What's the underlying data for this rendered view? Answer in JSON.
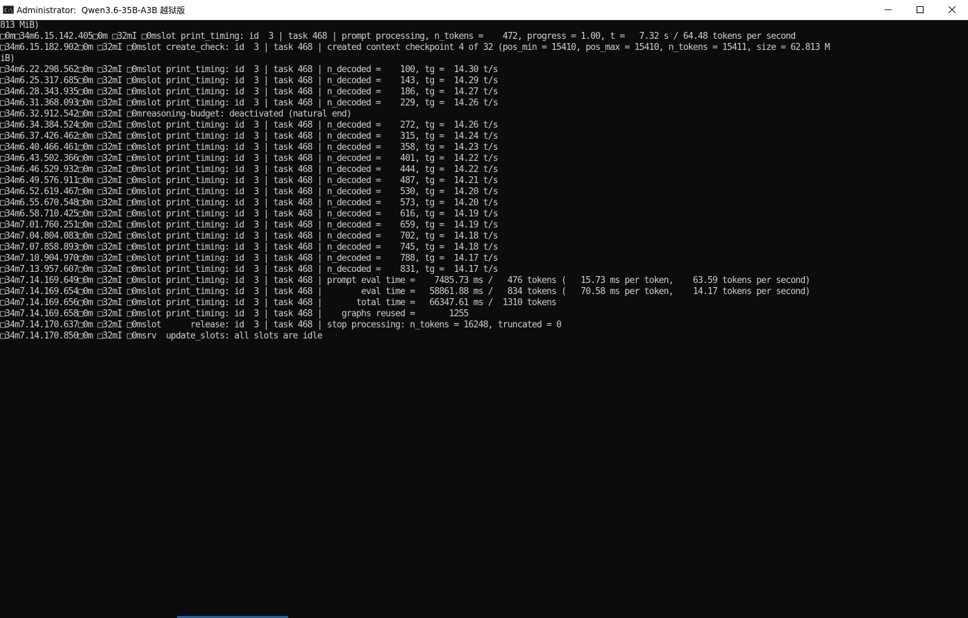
{
  "window": {
    "title": "Administrator:  Qwen3.6-35B-A3B 越狱版",
    "icon": "console-icon",
    "controls": {
      "minimize": "minimize-icon",
      "maximize": "maximize-icon",
      "close": "close-icon"
    }
  },
  "console": {
    "lines": [
      "813 MiB)",
      "□0m□34m6.15.142.405□0m □32mI □0mslot print_timing: id  3 | task 468 | prompt processing, n_tokens =    472, progress = 1.00, t =   7.32 s / 64.48 tokens per second",
      "□34m6.15.182.902□0m □32mI □0mslot create_check: id  3 | task 468 | created context checkpoint 4 of 32 (pos_min = 15410, pos_max = 15410, n_tokens = 15411, size = 62.813 M",
      "iB)",
      "□34m6.22.298.562□0m □32mI □0mslot print_timing: id  3 | task 468 | n_decoded =    100, tg =  14.30 t/s",
      "□34m6.25.317.685□0m □32mI □0mslot print_timing: id  3 | task 468 | n_decoded =    143, tg =  14.29 t/s",
      "□34m6.28.343.935□0m □32mI □0mslot print_timing: id  3 | task 468 | n_decoded =    186, tg =  14.27 t/s",
      "□34m6.31.368.093□0m □32mI □0mslot print_timing: id  3 | task 468 | n_decoded =    229, tg =  14.26 t/s",
      "□34m6.32.912.542□0m □32mI □0mreasoning-budget: deactivated (natural end)",
      "□34m6.34.384.524□0m □32mI □0mslot print_timing: id  3 | task 468 | n_decoded =    272, tg =  14.26 t/s",
      "□34m6.37.426.462□0m □32mI □0mslot print_timing: id  3 | task 468 | n_decoded =    315, tg =  14.24 t/s",
      "□34m6.40.466.461□0m □32mI □0mslot print_timing: id  3 | task 468 | n_decoded =    358, tg =  14.23 t/s",
      "□34m6.43.502.366□0m □32mI □0mslot print_timing: id  3 | task 468 | n_decoded =    401, tg =  14.22 t/s",
      "□34m6.46.529.932□0m □32mI □0mslot print_timing: id  3 | task 468 | n_decoded =    444, tg =  14.22 t/s",
      "□34m6.49.576.911□0m □32mI □0mslot print_timing: id  3 | task 468 | n_decoded =    487, tg =  14.21 t/s",
      "□34m6.52.619.467□0m □32mI □0mslot print_timing: id  3 | task 468 | n_decoded =    530, tg =  14.20 t/s",
      "□34m6.55.670.548□0m □32mI □0mslot print_timing: id  3 | task 468 | n_decoded =    573, tg =  14.20 t/s",
      "□34m6.58.710.425□0m □32mI □0mslot print_timing: id  3 | task 468 | n_decoded =    616, tg =  14.19 t/s",
      "□34m7.01.760.251□0m □32mI □0mslot print_timing: id  3 | task 468 | n_decoded =    659, tg =  14.19 t/s",
      "□34m7.04.804.083□0m □32mI □0mslot print_timing: id  3 | task 468 | n_decoded =    702, tg =  14.18 t/s",
      "□34m7.07.858.893□0m □32mI □0mslot print_timing: id  3 | task 468 | n_decoded =    745, tg =  14.18 t/s",
      "□34m7.10.904.970□0m □32mI □0mslot print_timing: id  3 | task 468 | n_decoded =    788, tg =  14.17 t/s",
      "□34m7.13.957.607□0m □32mI □0mslot print_timing: id  3 | task 468 | n_decoded =    831, tg =  14.17 t/s",
      "□34m7.14.169.649□0m □32mI □0mslot print_timing: id  3 | task 468 | prompt eval time =    7485.73 ms /   476 tokens (   15.73 ms per token,    63.59 tokens per second)",
      "□34m7.14.169.654□0m □32mI □0mslot print_timing: id  3 | task 468 |        eval time =   58861.88 ms /   834 tokens (   70.58 ms per token,    14.17 tokens per second)",
      "□34m7.14.169.656□0m □32mI □0mslot print_timing: id  3 | task 468 |       total time =   66347.61 ms /  1310 tokens",
      "□34m7.14.169.658□0m □32mI □0mslot print_timing: id  3 | task 468 |    graphs reused =       1255",
      "□34m7.14.170.637□0m □32mI □0mslot      release: id  3 | task 468 | stop processing: n_tokens = 16248, truncated = 0",
      "□34m7.14.170.850□0m □32mI □0msrv  update_slots: all slots are idle"
    ]
  },
  "colors": {
    "background": "#0c0c0c",
    "text": "#cccccc",
    "titlebar": "#ffffff"
  }
}
